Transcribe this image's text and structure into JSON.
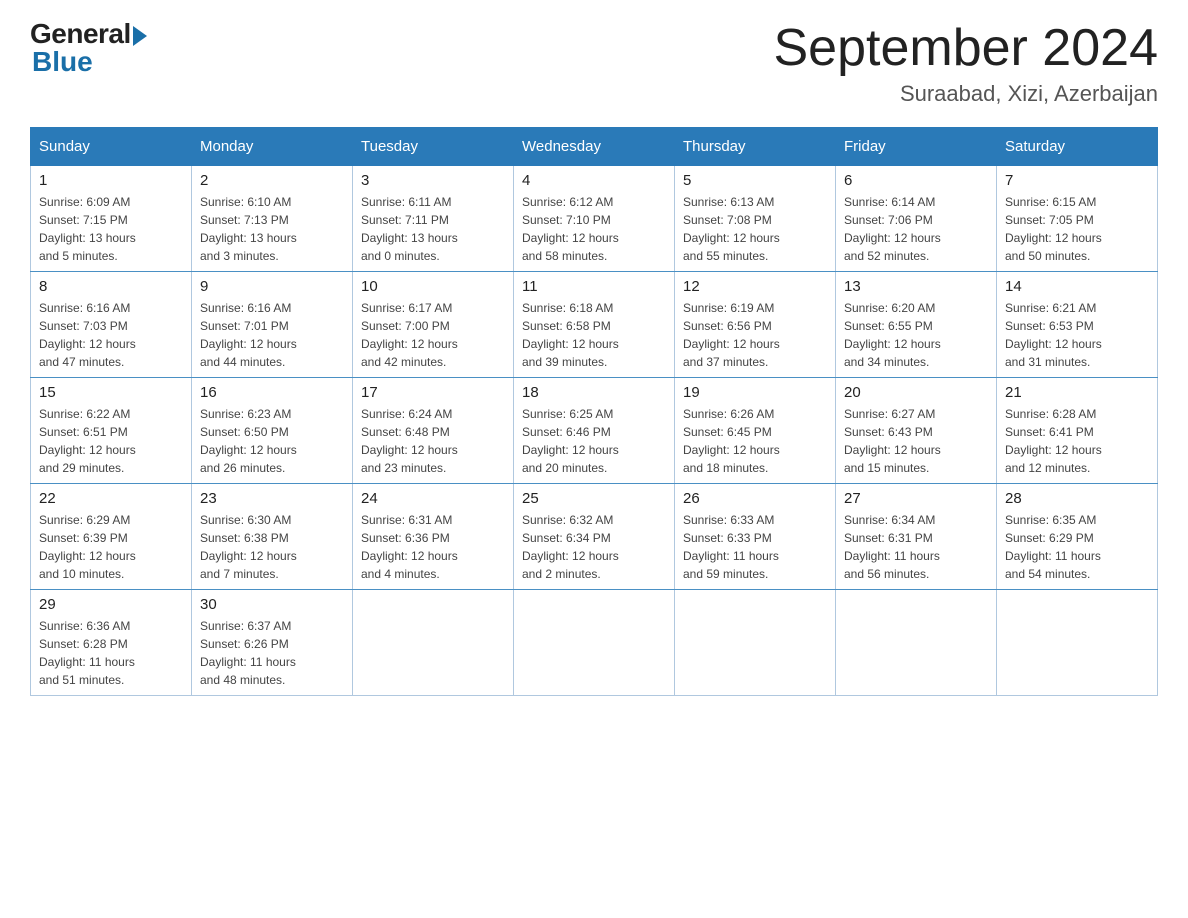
{
  "header": {
    "logo_general": "General",
    "logo_blue": "Blue",
    "month_title": "September 2024",
    "location": "Suraabad, Xizi, Azerbaijan"
  },
  "days_of_week": [
    "Sunday",
    "Monday",
    "Tuesday",
    "Wednesday",
    "Thursday",
    "Friday",
    "Saturday"
  ],
  "weeks": [
    [
      {
        "day": "1",
        "sunrise": "6:09 AM",
        "sunset": "7:15 PM",
        "daylight": "13 hours and 5 minutes."
      },
      {
        "day": "2",
        "sunrise": "6:10 AM",
        "sunset": "7:13 PM",
        "daylight": "13 hours and 3 minutes."
      },
      {
        "day": "3",
        "sunrise": "6:11 AM",
        "sunset": "7:11 PM",
        "daylight": "13 hours and 0 minutes."
      },
      {
        "day": "4",
        "sunrise": "6:12 AM",
        "sunset": "7:10 PM",
        "daylight": "12 hours and 58 minutes."
      },
      {
        "day": "5",
        "sunrise": "6:13 AM",
        "sunset": "7:08 PM",
        "daylight": "12 hours and 55 minutes."
      },
      {
        "day": "6",
        "sunrise": "6:14 AM",
        "sunset": "7:06 PM",
        "daylight": "12 hours and 52 minutes."
      },
      {
        "day": "7",
        "sunrise": "6:15 AM",
        "sunset": "7:05 PM",
        "daylight": "12 hours and 50 minutes."
      }
    ],
    [
      {
        "day": "8",
        "sunrise": "6:16 AM",
        "sunset": "7:03 PM",
        "daylight": "12 hours and 47 minutes."
      },
      {
        "day": "9",
        "sunrise": "6:16 AM",
        "sunset": "7:01 PM",
        "daylight": "12 hours and 44 minutes."
      },
      {
        "day": "10",
        "sunrise": "6:17 AM",
        "sunset": "7:00 PM",
        "daylight": "12 hours and 42 minutes."
      },
      {
        "day": "11",
        "sunrise": "6:18 AM",
        "sunset": "6:58 PM",
        "daylight": "12 hours and 39 minutes."
      },
      {
        "day": "12",
        "sunrise": "6:19 AM",
        "sunset": "6:56 PM",
        "daylight": "12 hours and 37 minutes."
      },
      {
        "day": "13",
        "sunrise": "6:20 AM",
        "sunset": "6:55 PM",
        "daylight": "12 hours and 34 minutes."
      },
      {
        "day": "14",
        "sunrise": "6:21 AM",
        "sunset": "6:53 PM",
        "daylight": "12 hours and 31 minutes."
      }
    ],
    [
      {
        "day": "15",
        "sunrise": "6:22 AM",
        "sunset": "6:51 PM",
        "daylight": "12 hours and 29 minutes."
      },
      {
        "day": "16",
        "sunrise": "6:23 AM",
        "sunset": "6:50 PM",
        "daylight": "12 hours and 26 minutes."
      },
      {
        "day": "17",
        "sunrise": "6:24 AM",
        "sunset": "6:48 PM",
        "daylight": "12 hours and 23 minutes."
      },
      {
        "day": "18",
        "sunrise": "6:25 AM",
        "sunset": "6:46 PM",
        "daylight": "12 hours and 20 minutes."
      },
      {
        "day": "19",
        "sunrise": "6:26 AM",
        "sunset": "6:45 PM",
        "daylight": "12 hours and 18 minutes."
      },
      {
        "day": "20",
        "sunrise": "6:27 AM",
        "sunset": "6:43 PM",
        "daylight": "12 hours and 15 minutes."
      },
      {
        "day": "21",
        "sunrise": "6:28 AM",
        "sunset": "6:41 PM",
        "daylight": "12 hours and 12 minutes."
      }
    ],
    [
      {
        "day": "22",
        "sunrise": "6:29 AM",
        "sunset": "6:39 PM",
        "daylight": "12 hours and 10 minutes."
      },
      {
        "day": "23",
        "sunrise": "6:30 AM",
        "sunset": "6:38 PM",
        "daylight": "12 hours and 7 minutes."
      },
      {
        "day": "24",
        "sunrise": "6:31 AM",
        "sunset": "6:36 PM",
        "daylight": "12 hours and 4 minutes."
      },
      {
        "day": "25",
        "sunrise": "6:32 AM",
        "sunset": "6:34 PM",
        "daylight": "12 hours and 2 minutes."
      },
      {
        "day": "26",
        "sunrise": "6:33 AM",
        "sunset": "6:33 PM",
        "daylight": "11 hours and 59 minutes."
      },
      {
        "day": "27",
        "sunrise": "6:34 AM",
        "sunset": "6:31 PM",
        "daylight": "11 hours and 56 minutes."
      },
      {
        "day": "28",
        "sunrise": "6:35 AM",
        "sunset": "6:29 PM",
        "daylight": "11 hours and 54 minutes."
      }
    ],
    [
      {
        "day": "29",
        "sunrise": "6:36 AM",
        "sunset": "6:28 PM",
        "daylight": "11 hours and 51 minutes."
      },
      {
        "day": "30",
        "sunrise": "6:37 AM",
        "sunset": "6:26 PM",
        "daylight": "11 hours and 48 minutes."
      },
      null,
      null,
      null,
      null,
      null
    ]
  ],
  "labels": {
    "sunrise": "Sunrise:",
    "sunset": "Sunset:",
    "daylight": "Daylight:"
  }
}
